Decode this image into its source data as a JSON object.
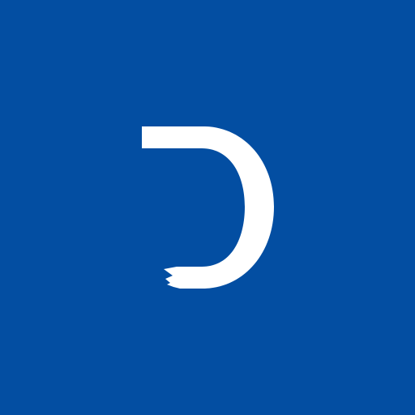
{
  "colors": {
    "background": "#034ea2",
    "mark": "#ffffff"
  },
  "icon": {
    "name": "d-shaped-logo-icon"
  }
}
